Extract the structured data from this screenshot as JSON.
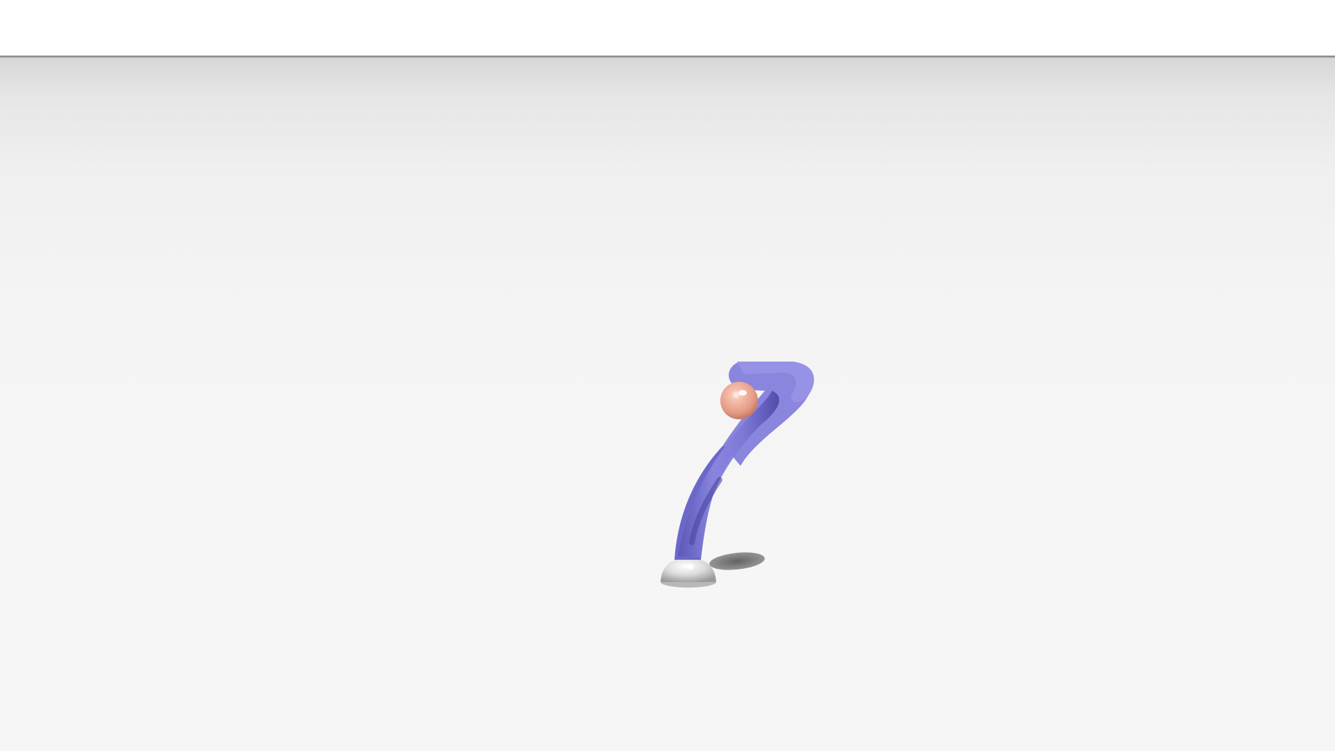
{
  "scene": {
    "floor_color": "#f5f5f5",
    "horizon_color": "#d6d6d6",
    "objects": [
      {
        "name": "base",
        "color": "#e2e2e2"
      },
      {
        "name": "arm-link",
        "color": "#7f7bd6"
      },
      {
        "name": "end-effector",
        "color": "#f2a98f"
      }
    ]
  }
}
